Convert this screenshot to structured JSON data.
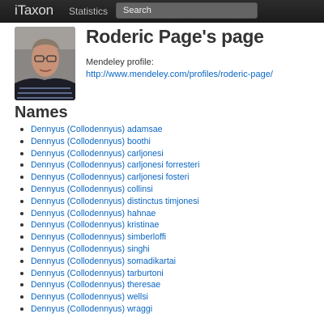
{
  "navbar": {
    "brand": "iTaxon",
    "links": [
      "Statistics"
    ],
    "search_placeholder": "Search"
  },
  "profile": {
    "title": "Roderic Page's page",
    "mendeley_label": "Mendeley profile:",
    "mendeley_url": "http://www.mendeley.com/profiles/roderic-page/"
  },
  "names": {
    "heading": "Names",
    "items": [
      "Dennyus (Collodennyus) adamsae",
      "Dennyus (Collodennyus) boothi",
      "Dennyus (Collodennyus) carljonesi",
      "Dennyus (Collodennyus) carljonesi forresteri",
      "Dennyus (Collodennyus) carljonesi fosteri",
      "Dennyus (Collodennyus) collinsi",
      "Dennyus (Collodennyus) distinctus timjonesi",
      "Dennyus (Collodennyus) hahnae",
      "Dennyus (Collodennyus) kristinae",
      "Dennyus (Collodennyus) simberloffi",
      "Dennyus (Collodennyus) singhi",
      "Dennyus (Collodennyus) somadikartai",
      "Dennyus (Collodennyus) tarburtoni",
      "Dennyus (Collodennyus) theresae",
      "Dennyus (Collodennyus) wellsi",
      "Dennyus (Collodennyus) wraggi"
    ]
  },
  "colors": {
    "navbar_bg": "#222222",
    "link": "#0a66c2",
    "text": "#333333"
  }
}
